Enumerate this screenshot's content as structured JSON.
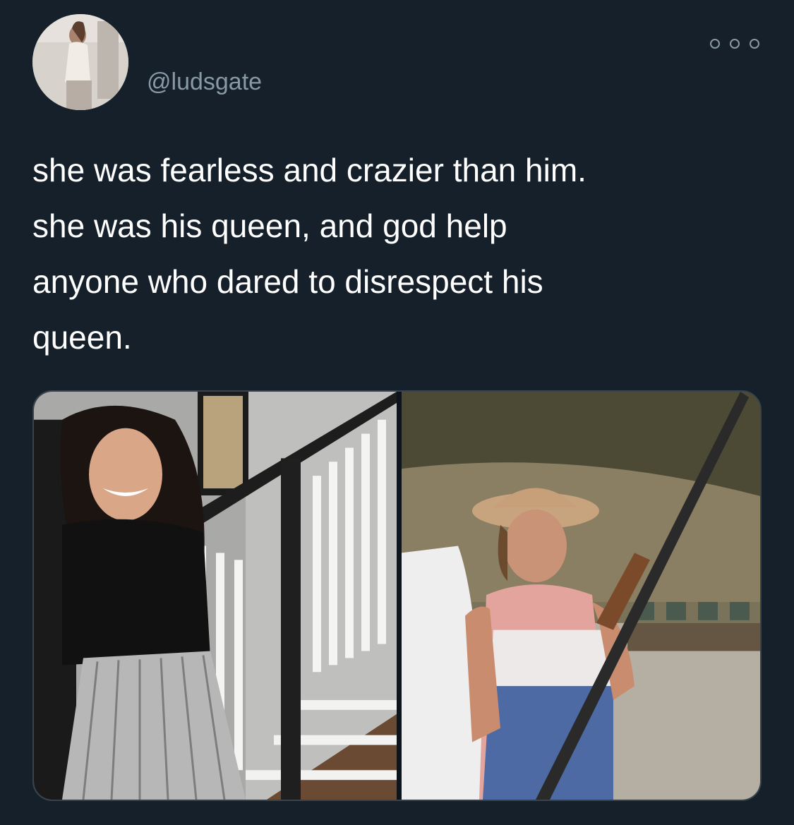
{
  "tweet": {
    "handle": "@ludsgate",
    "text": "she was fearless and crazier than him.\nshe was his queen, and god help\nanyone who dared to disrespect his\nqueen.",
    "more_icon": "more-horizontal-icon",
    "avatar": "user-avatar",
    "media": [
      {
        "name": "photo-woman-smiling-staircase"
      },
      {
        "name": "photo-young-man-cowboy-hat-shotgun"
      }
    ]
  },
  "colors": {
    "background": "#15202b",
    "secondary_text": "#8899a6",
    "primary_text": "#ffffff",
    "border": "#38444d"
  }
}
